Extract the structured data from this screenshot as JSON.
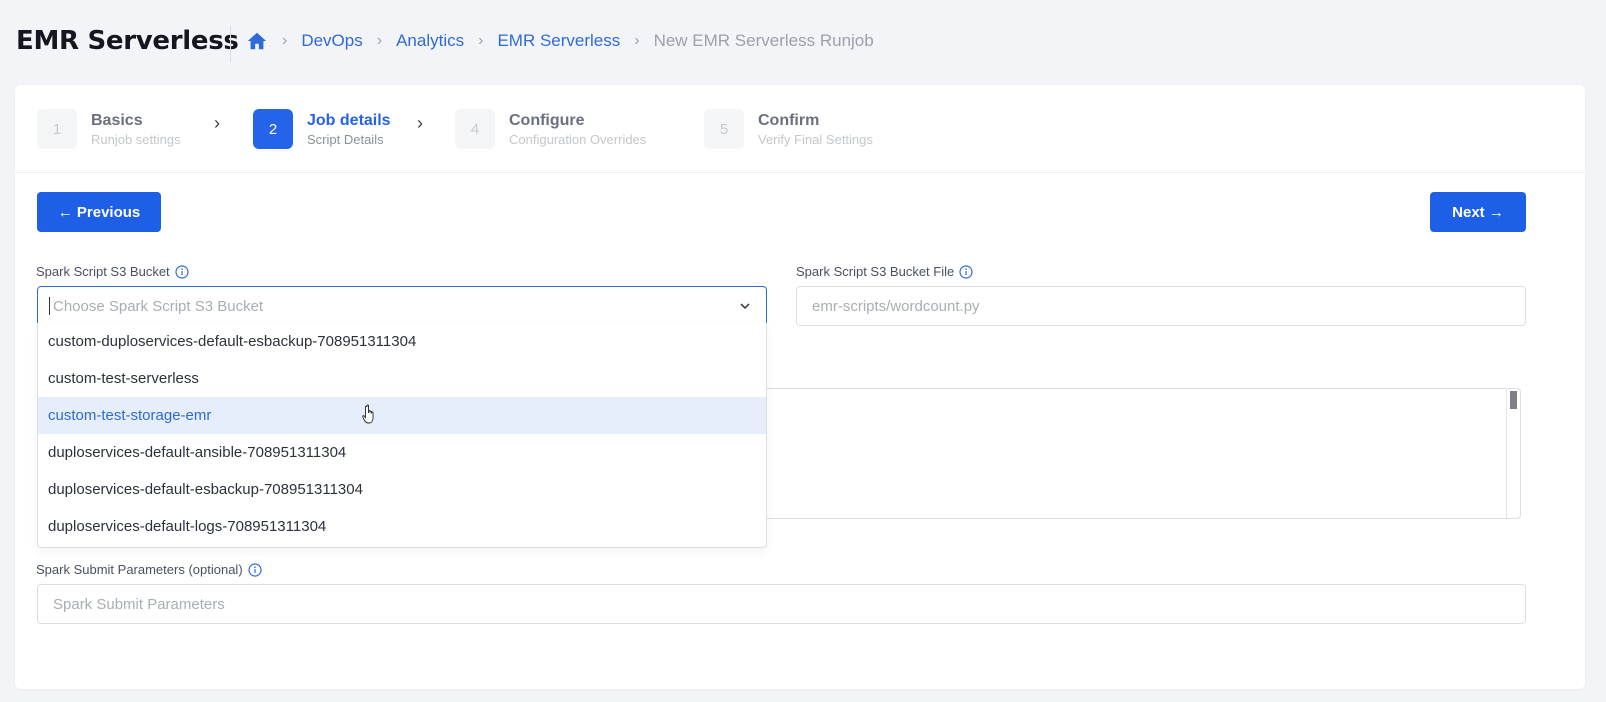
{
  "app_title": "EMR Serverless",
  "breadcrumb": {
    "home_icon": "home-icon",
    "items": [
      "DevOps",
      "Analytics",
      "EMR Serverless"
    ],
    "current": "New EMR Serverless Runjob"
  },
  "steps": [
    {
      "num": "1",
      "title": "Basics",
      "subtitle": "Runjob settings",
      "state": "inactive"
    },
    {
      "num": "2",
      "title": "Job details",
      "subtitle": "Script Details",
      "state": "active"
    },
    {
      "num": "4",
      "title": "Configure",
      "subtitle": "Configuration Overrides",
      "state": "inactive"
    },
    {
      "num": "5",
      "title": "Confirm",
      "subtitle": "Verify Final Settings",
      "state": "inactive"
    }
  ],
  "buttons": {
    "previous": "← Previous",
    "next": "Next →"
  },
  "bucket_field": {
    "label": "Spark Script S3 Bucket",
    "placeholder": "Choose Spark Script S3 Bucket",
    "options": [
      "custom-duploservices-default-esbackup-708951311304",
      "custom-test-serverless",
      "custom-test-storage-emr",
      "duploservices-default-ansible-708951311304",
      "duploservices-default-esbackup-708951311304",
      "duploservices-default-logs-708951311304"
    ],
    "hovered_option": "custom-test-storage-emr"
  },
  "file_field": {
    "label": "Spark Script S3 Bucket File",
    "placeholder": "emr-scripts/wordcount.py"
  },
  "params_field": {
    "label": "Spark Submit Parameters (optional)",
    "placeholder": "Spark Submit Parameters"
  },
  "colors": {
    "accent": "#2563eb",
    "hover_bg": "#e6edfb",
    "background": "#f3f4f7"
  }
}
